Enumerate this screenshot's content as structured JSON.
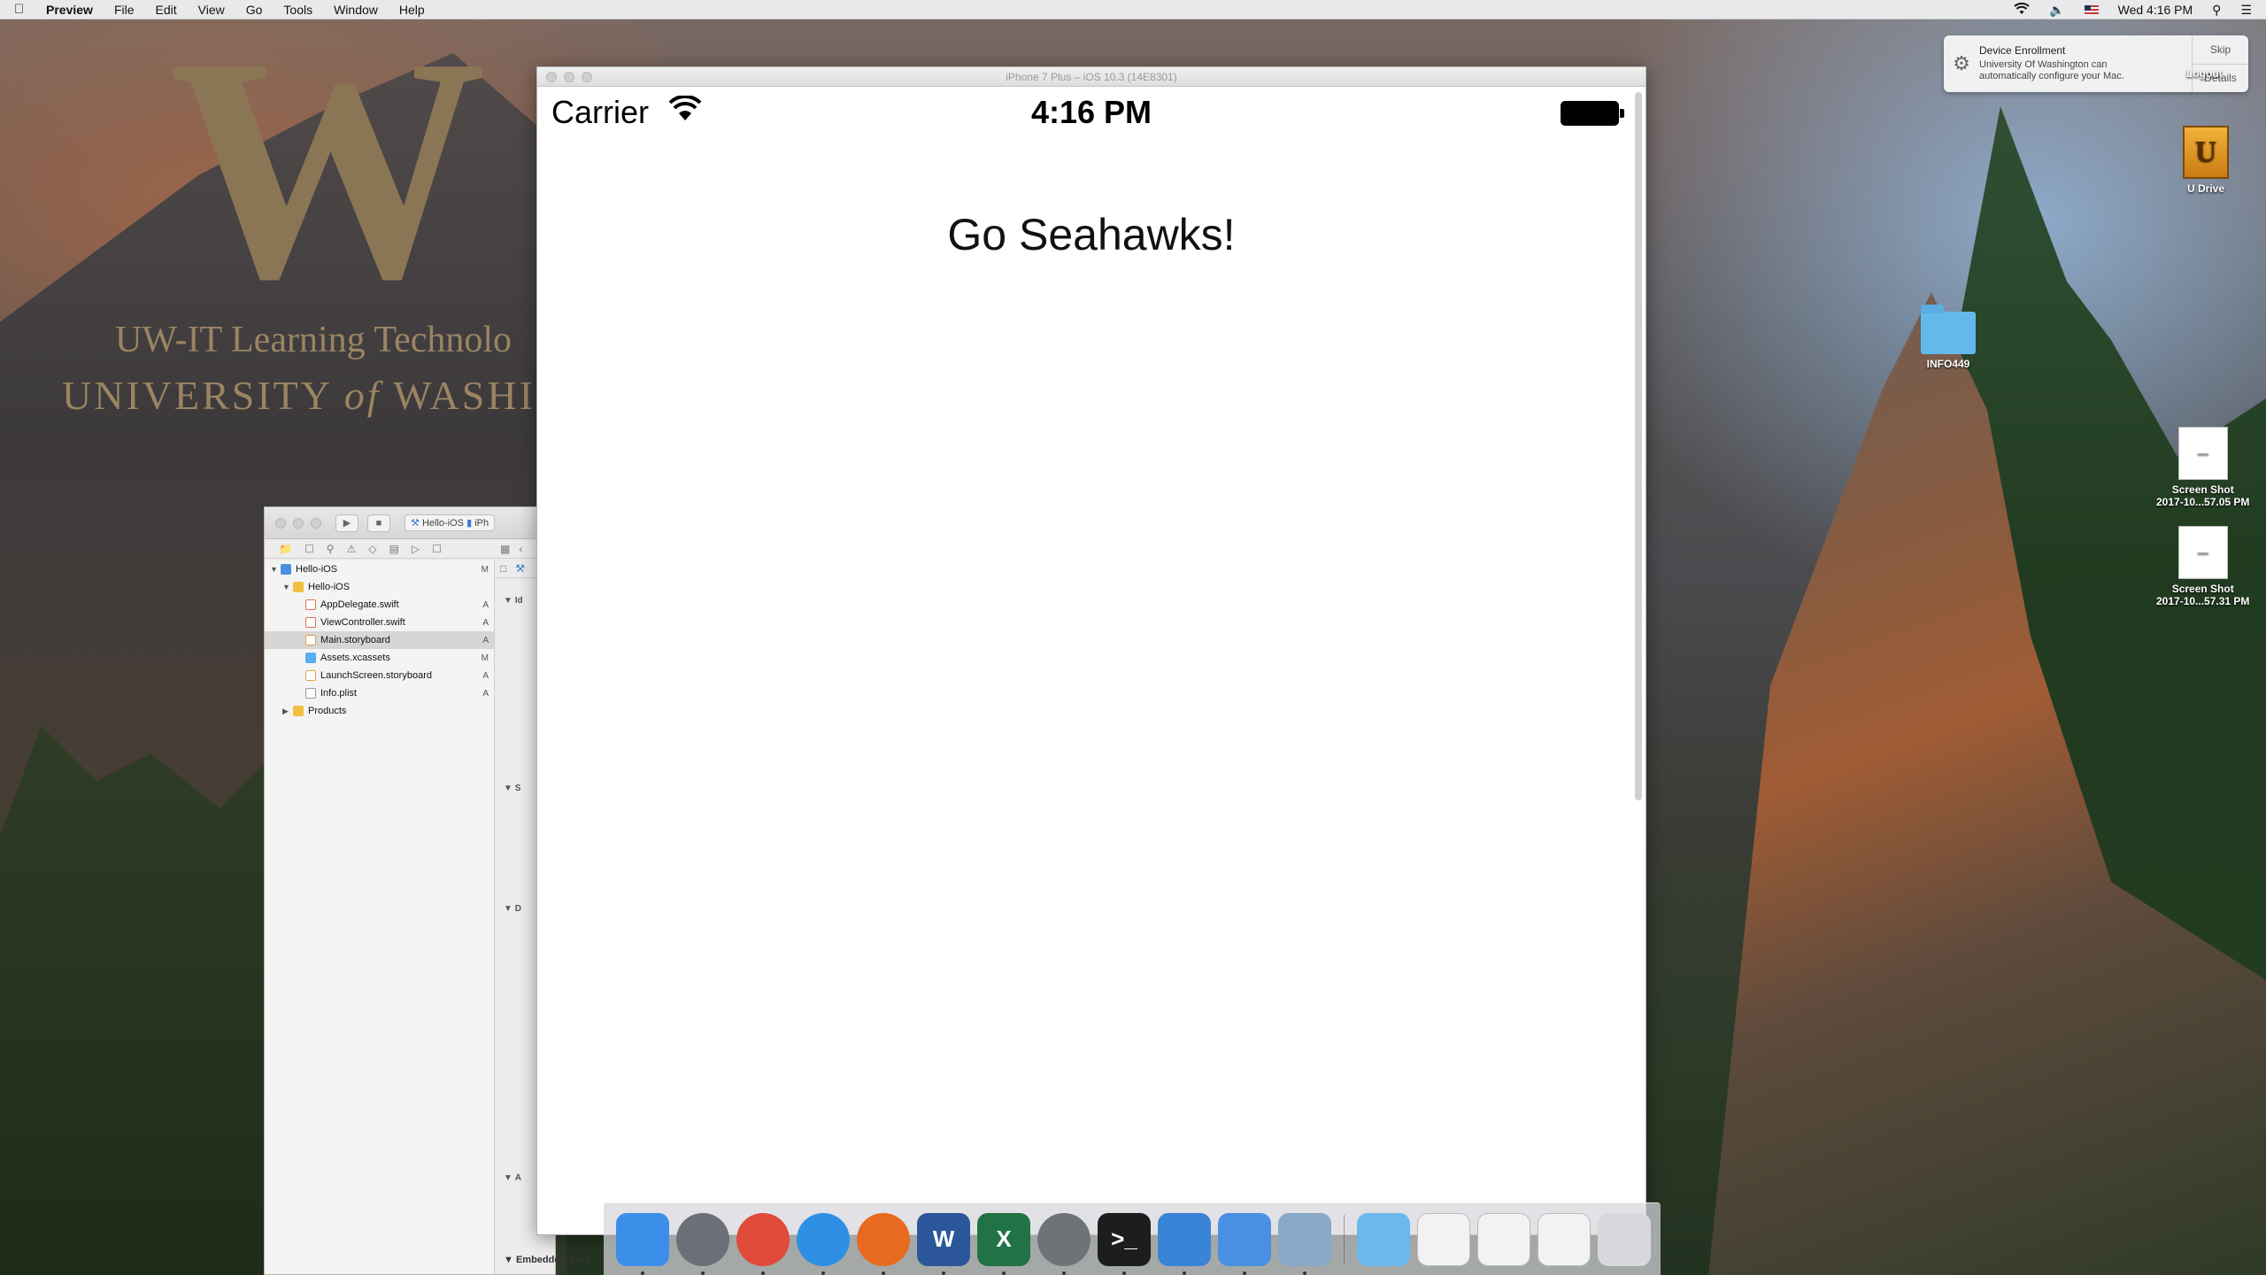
{
  "menubar": {
    "app_name": "Preview",
    "items": [
      "File",
      "Edit",
      "View",
      "Go",
      "Tools",
      "Window",
      "Help"
    ],
    "clock": "Wed 4:16 PM"
  },
  "wallpaper": {
    "logo_letter": "W",
    "line1": "UW-IT Learning Technolo",
    "line2_a": "UNIVERSITY ",
    "line2_of": "of",
    "line2_b": " WASHIN"
  },
  "notification": {
    "title": "Device Enrollment",
    "body": "University Of Washington can automatically configure your Mac.",
    "skip": "Skip",
    "details": "Details"
  },
  "desktop_icons": {
    "logout": "Logout",
    "udrive": "U Drive",
    "udrive_glyph": "U",
    "folder": "INFO449",
    "shot1_a": "Screen Shot",
    "shot1_b": "2017-10...57.05 PM",
    "shot2_a": "Screen Shot",
    "shot2_b": "2017-10...57.31 PM"
  },
  "xcode": {
    "scheme": "Hello-iOS",
    "scheme_device": "iPh",
    "tree": [
      {
        "label": "Hello-iOS",
        "status": "M",
        "icon": "project-icon",
        "indent": 0,
        "tri": "▼"
      },
      {
        "label": "Hello-iOS",
        "status": "",
        "icon": "folder-icon",
        "indent": 1,
        "tri": "▼"
      },
      {
        "label": "AppDelegate.swift",
        "status": "A",
        "icon": "swift-file-icon",
        "indent": 2,
        "tri": ""
      },
      {
        "label": "ViewController.swift",
        "status": "A",
        "icon": "swift-file-icon",
        "indent": 2,
        "tri": ""
      },
      {
        "label": "Main.storyboard",
        "status": "A",
        "icon": "storyboard-file-icon",
        "indent": 2,
        "tri": "",
        "selected": true
      },
      {
        "label": "Assets.xcassets",
        "status": "M",
        "icon": "assets-icon",
        "indent": 2,
        "tri": ""
      },
      {
        "label": "LaunchScreen.storyboard",
        "status": "A",
        "icon": "storyboard-file-icon",
        "indent": 2,
        "tri": ""
      },
      {
        "label": "Info.plist",
        "status": "A",
        "icon": "plist-file-icon",
        "indent": 2,
        "tri": ""
      },
      {
        "label": "Products",
        "status": "",
        "icon": "folder-icon",
        "indent": 1,
        "tri": "▶"
      }
    ],
    "inspector_sections": [
      "Id",
      "S",
      "D",
      "A"
    ],
    "embedded_label": "Embedded Bina"
  },
  "simulator": {
    "window_title": "iPhone 7 Plus – iOS 10.3 (14E8301)",
    "carrier": "Carrier",
    "time": "4:16 PM",
    "headline": "Go Seahawks!"
  },
  "dock": {
    "apps": [
      {
        "name": "finder-icon",
        "color": "#3b8fe8",
        "glyph": ""
      },
      {
        "name": "launchpad-icon",
        "color": "#6a6f78",
        "glyph": ""
      },
      {
        "name": "chrome-icon",
        "color": "#e04a3a",
        "glyph": ""
      },
      {
        "name": "safari-icon",
        "color": "#2f8fe5",
        "glyph": ""
      },
      {
        "name": "firefox-icon",
        "color": "#e86a20",
        "glyph": ""
      },
      {
        "name": "word-icon",
        "color": "#2b579a",
        "glyph": "W"
      },
      {
        "name": "excel-icon",
        "color": "#217346",
        "glyph": "X"
      },
      {
        "name": "system-preferences-icon",
        "color": "#6e7378",
        "glyph": ""
      },
      {
        "name": "terminal-icon",
        "color": "#1d1d1d",
        "glyph": ">_"
      },
      {
        "name": "xcode-icon",
        "color": "#3a84d8",
        "glyph": ""
      },
      {
        "name": "simulator-icon",
        "color": "#4a90e2",
        "glyph": ""
      },
      {
        "name": "preview-icon",
        "color": "#8aa8c8",
        "glyph": ""
      }
    ],
    "right": [
      {
        "name": "downloads-folder-icon",
        "color": "#6cb8ec"
      },
      {
        "name": "chrome-window-thumbnail-icon",
        "color": "#f2f2f2"
      },
      {
        "name": "screenshot-thumbnail-icon",
        "color": "#f2f2f2"
      },
      {
        "name": "screenshot-thumbnail-icon-2",
        "color": "#f2f2f2"
      },
      {
        "name": "trash-icon",
        "color": "#d6d8dc"
      }
    ]
  }
}
